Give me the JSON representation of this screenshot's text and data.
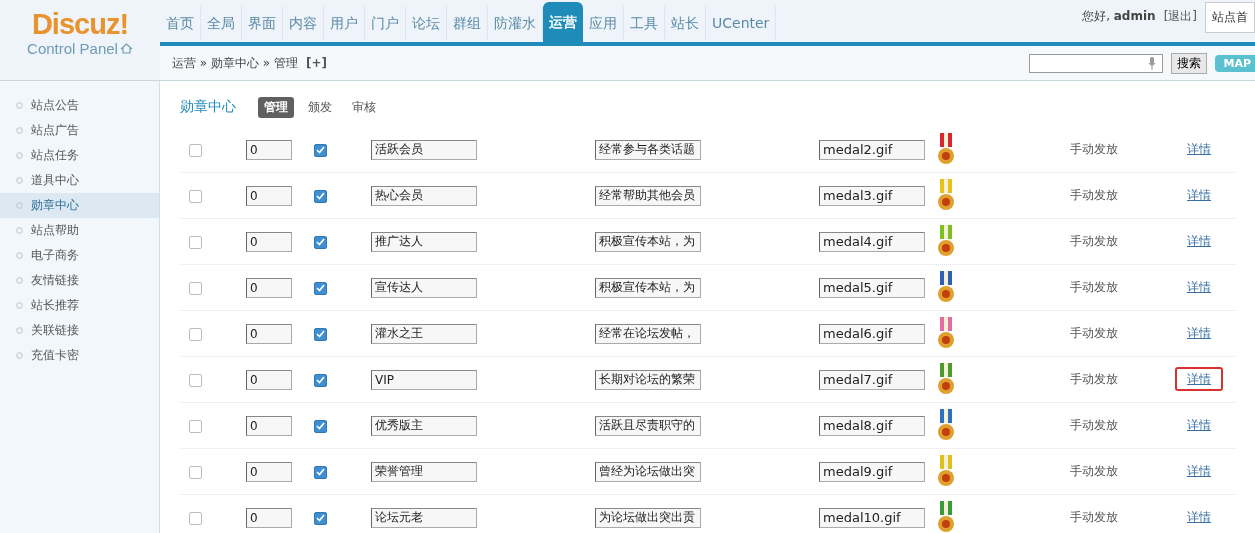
{
  "logo": {
    "brand": "Discuz!",
    "subtitle": "Control Panel"
  },
  "nav": [
    {
      "label": "首页",
      "selected": false
    },
    {
      "label": "全局",
      "selected": false
    },
    {
      "label": "界面",
      "selected": false
    },
    {
      "label": "内容",
      "selected": false
    },
    {
      "label": "用户",
      "selected": false
    },
    {
      "label": "门户",
      "selected": false
    },
    {
      "label": "论坛",
      "selected": false
    },
    {
      "label": "群组",
      "selected": false
    },
    {
      "label": "防灌水",
      "selected": false
    },
    {
      "label": "运营",
      "selected": true
    },
    {
      "label": "应用",
      "selected": false
    },
    {
      "label": "工具",
      "selected": false
    },
    {
      "label": "站长",
      "selected": false
    },
    {
      "label": "UCenter",
      "selected": false
    }
  ],
  "user": {
    "greeting": "您好, **admin**",
    "logout": "[退出]",
    "site_home": "站点首"
  },
  "breadcrumb": {
    "path": "运营 » 勋章中心 » 管理",
    "add": "[+]"
  },
  "search": {
    "button": "搜索",
    "map": "MAP"
  },
  "sidebar": [
    {
      "label": "站点公告",
      "selected": false
    },
    {
      "label": "站点广告",
      "selected": false
    },
    {
      "label": "站点任务",
      "selected": false
    },
    {
      "label": "道具中心",
      "selected": false
    },
    {
      "label": "勋章中心",
      "selected": true
    },
    {
      "label": "站点帮助",
      "selected": false
    },
    {
      "label": "电子商务",
      "selected": false
    },
    {
      "label": "友情链接",
      "selected": false
    },
    {
      "label": "站长推荐",
      "selected": false
    },
    {
      "label": "关联链接",
      "selected": false
    },
    {
      "label": "充值卡密",
      "selected": false
    }
  ],
  "section": {
    "title": "勋章中心",
    "tabs": [
      {
        "label": "管理",
        "selected": true
      },
      {
        "label": "颁发",
        "selected": false
      },
      {
        "label": "审核",
        "selected": false
      }
    ]
  },
  "rows": [
    {
      "checked": false,
      "order": "0",
      "available": true,
      "name": "活跃会员",
      "description": "经常参与各类话题",
      "image": "medal2.gif",
      "color": "#d9272e",
      "award": "手动发放",
      "link": "详情",
      "highlighted": false
    },
    {
      "checked": false,
      "order": "0",
      "available": true,
      "name": "热心会员",
      "description": "经常帮助其他会员",
      "image": "medal3.gif",
      "color": "#e8c21a",
      "award": "手动发放",
      "link": "详情",
      "highlighted": false
    },
    {
      "checked": false,
      "order": "0",
      "available": true,
      "name": "推广达人",
      "description": "积极宣传本站，为",
      "image": "medal4.gif",
      "color": "#7cbf1e",
      "award": "手动发放",
      "link": "详情",
      "highlighted": false
    },
    {
      "checked": false,
      "order": "0",
      "available": true,
      "name": "宣传达人",
      "description": "积极宣传本站，为",
      "image": "medal5.gif",
      "color": "#2f5fb0",
      "award": "手动发放",
      "link": "详情",
      "highlighted": false
    },
    {
      "checked": false,
      "order": "0",
      "available": true,
      "name": "灌水之王",
      "description": "经常在论坛发帖，",
      "image": "medal6.gif",
      "color": "#e46ca0",
      "award": "手动发放",
      "link": "详情",
      "highlighted": false
    },
    {
      "checked": false,
      "order": "0",
      "available": true,
      "name": "VIP",
      "description": "长期对论坛的繁荣",
      "image": "medal7.gif",
      "color": "#4f9a2a",
      "award": "手动发放",
      "link": "详情",
      "highlighted": true
    },
    {
      "checked": false,
      "order": "0",
      "available": true,
      "name": "优秀版主",
      "description": "活跃且尽责职守的",
      "image": "medal8.gif",
      "color": "#2d6fc0",
      "award": "手动发放",
      "link": "详情",
      "highlighted": false
    },
    {
      "checked": false,
      "order": "0",
      "available": true,
      "name": "荣誉管理",
      "description": "曾经为论坛做出突",
      "image": "medal9.gif",
      "color": "#e0c020",
      "award": "手动发放",
      "link": "详情",
      "highlighted": false
    },
    {
      "checked": false,
      "order": "0",
      "available": true,
      "name": "论坛元老",
      "description": "为论坛做出突出贡",
      "image": "medal10.gif",
      "color": "#3a9a3a",
      "award": "手动发放",
      "link": "详情",
      "highlighted": false
    }
  ]
}
